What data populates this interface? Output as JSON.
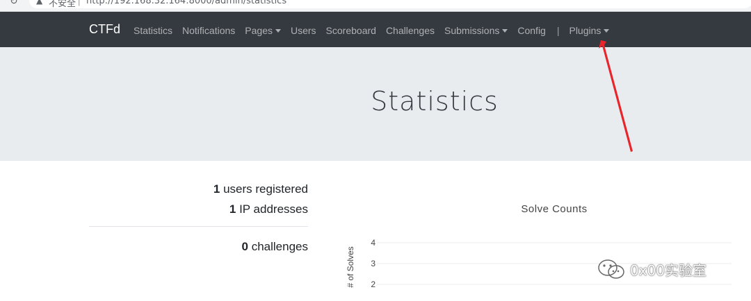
{
  "browser": {
    "security_label": "不安全",
    "url": "http://192.168.32.164:8000/admin/statistics"
  },
  "navbar": {
    "brand": "CTFd",
    "items": [
      {
        "label": "Statistics"
      },
      {
        "label": "Notifications"
      },
      {
        "label": "Pages"
      },
      {
        "label": "Users"
      },
      {
        "label": "Scoreboard"
      },
      {
        "label": "Challenges"
      },
      {
        "label": "Submissions"
      },
      {
        "label": "Config"
      },
      {
        "label": "Plugins"
      }
    ],
    "divider": "|"
  },
  "page": {
    "title": "Statistics"
  },
  "stats": {
    "users_count": "1",
    "users_label": " users registered",
    "ip_count": "1",
    "ip_label": " IP addresses",
    "challenges_count": "0",
    "challenges_label": " challenges"
  },
  "chart_data": {
    "type": "bar",
    "title": "Solve Counts",
    "ylabel": "# of Solves",
    "ylim": [
      2,
      4
    ],
    "yticks": [
      "4",
      "3",
      "2"
    ],
    "categories": [],
    "values": [],
    "grid": true
  },
  "watermark": {
    "text": "0x00实验室"
  },
  "colors": {
    "navbar_bg": "#343a40",
    "jumbotron_bg": "#e9ecef",
    "annotation_arrow": "#e8252b"
  }
}
